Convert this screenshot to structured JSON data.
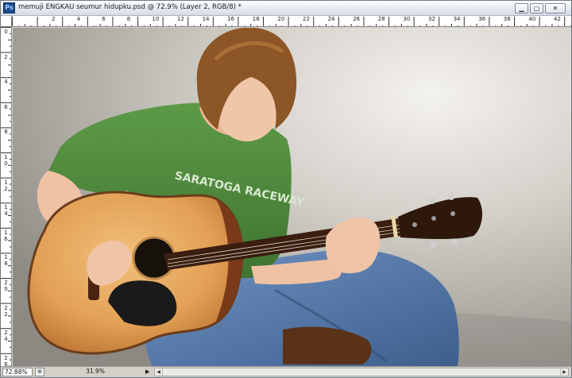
{
  "window": {
    "app_icon": "Ps",
    "title": "memuji ENGKAU seumur hidupku.psd @ 72.9% (Layer 2, RGB/8) *",
    "controls": {
      "minimize_icon": "minimize-icon",
      "maximize_icon": "maximize-icon",
      "close_icon": "close-icon"
    }
  },
  "ruler_top": {
    "labels": [
      "2",
      "4",
      "6",
      "8",
      "10",
      "12",
      "14",
      "16",
      "18",
      "20",
      "22",
      "24",
      "26",
      "28",
      "30",
      "32",
      "34",
      "36",
      "38",
      "40",
      "42",
      "44"
    ]
  },
  "ruler_left": {
    "labels": [
      "0",
      "2",
      "4",
      "6",
      "8",
      "10",
      "12",
      "14",
      "16",
      "18",
      "20",
      "22",
      "24",
      "26"
    ]
  },
  "status": {
    "zoom": "72.88%",
    "doc_info": "31.9%",
    "arrow": "▶",
    "scroll_left": "◀",
    "scroll_right": "▶"
  },
  "canvas": {
    "shirt_text": "SARATOGA RACEWAY",
    "colors": {
      "shirt": "#4e8a3c",
      "guitar_top": "#e7a65a",
      "jeans": "#4f77a8",
      "hair": "#8a5524",
      "wall": "#cfcbc5"
    }
  }
}
